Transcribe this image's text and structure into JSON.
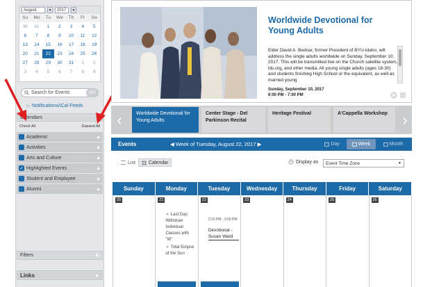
{
  "mini_calendar": {
    "month": "August",
    "year": "2017",
    "dow": [
      "Su",
      "Mo",
      "Tu",
      "We",
      "Th",
      "Fr",
      "Sa"
    ],
    "weeks": [
      [
        "30",
        "31",
        "1",
        "2",
        "3",
        "4",
        "5"
      ],
      [
        "6",
        "7",
        "8",
        "9",
        "10",
        "11",
        "12"
      ],
      [
        "13",
        "14",
        "15",
        "16",
        "17",
        "18",
        "19"
      ],
      [
        "20",
        "21",
        "22",
        "23",
        "24",
        "25",
        "26"
      ],
      [
        "27",
        "28",
        "29",
        "30",
        "31",
        "1",
        "2"
      ],
      [
        "3",
        "4",
        "5",
        "6",
        "7",
        "8",
        "9"
      ]
    ],
    "today": "22"
  },
  "search": {
    "placeholder": "Search for Events",
    "go_label": "GO"
  },
  "feeds_label": "Notifications/iCal Feeds",
  "calendars": {
    "title": "Calendars",
    "check_all": "Check All",
    "expand_all": "Expand All",
    "items": [
      {
        "label": "Academic",
        "checked": false
      },
      {
        "label": "Activities",
        "checked": false
      },
      {
        "label": "Arts and Culture",
        "checked": false
      },
      {
        "label": "Highlighted Events",
        "checked": true
      },
      {
        "label": "Student and Employee",
        "checked": false
      },
      {
        "label": "Alumni",
        "checked": false
      }
    ]
  },
  "filters_label": "Filters",
  "links_label": "Links",
  "hero": {
    "title": "Worldwide Devotional for Young Adults",
    "body": "Elder David A. Bednar, former President of BYU-Idaho, will address the single adults worldwide on Sunday, September 10, 2017. This will be transmitted live on the Church satellite system, lds.org, and other media. All young single adults (ages 18-30) and students finishing High School or the equivalent, as well as married young",
    "date": "Sunday, September 10, 2017",
    "time": "6:00 PM - 7:00 PM"
  },
  "carousel": [
    {
      "label": "Worldwide Devotional for Young Adults",
      "active": true
    },
    {
      "label": "Center Stage - Del Parkinson Recital",
      "active": false
    },
    {
      "label": "Heritage Festival",
      "active": false
    },
    {
      "label": "A'Cappella Workshop",
      "active": false
    }
  ],
  "events_bar": {
    "title": "Events",
    "week_label": "Week of Tuesday, August 22, 2017",
    "views": [
      "Day",
      "Week",
      "Month"
    ],
    "active_view": "Week"
  },
  "toolbar": {
    "list_label": "List",
    "calendar_label": "Calendar",
    "display_as_label": "Display as",
    "timezone_value": "Event Time Zone"
  },
  "week_calendar": {
    "days": [
      "Sunday",
      "Monday",
      "Tuesday",
      "Wednesday",
      "Thursday",
      "Friday",
      "Saturday"
    ],
    "dates": [
      "20",
      "21",
      "22",
      "23",
      "24",
      "25",
      "26"
    ],
    "monday_events": [
      "Last Day: Withdraw Individual Classes with \"W\"",
      "Total Eclipse of the Sun"
    ],
    "tuesday_event": {
      "time": "2:10 PM - 3:00 PM",
      "title": "Devotional - Susan Ward"
    }
  }
}
